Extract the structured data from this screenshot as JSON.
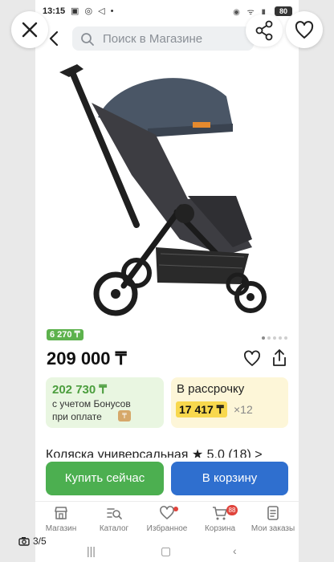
{
  "status_bar": {
    "time": "13:15",
    "left_icons": "▣ ◎ ◁ •",
    "right_icons": "◉ ᯤ ▮",
    "battery": "80"
  },
  "search": {
    "placeholder": "Поиск в Магазине"
  },
  "overlay": {
    "counter": "3/5"
  },
  "product": {
    "bonus": "6 270 ₸",
    "price": "209 000 ₸",
    "bonus_price": "202 730 ₸",
    "bonus_line1": "с учетом Бонусов",
    "bonus_line2": "при оплате",
    "installment_title": "В рассрочку",
    "installment_monthly": "17 417 ₸",
    "installment_mult": "×12",
    "title_cut": "Коляска универсальная ★ 5.0 (18) >",
    "image_pager": {
      "total": 5,
      "active": 0
    }
  },
  "actions": {
    "buy_now": "Купить сейчас",
    "to_cart": "В корзину"
  },
  "bottom_nav": [
    {
      "label": "Магазин",
      "icon": "store-icon"
    },
    {
      "label": "Каталог",
      "icon": "catalog-icon"
    },
    {
      "label": "Избранное",
      "icon": "heart-icon"
    },
    {
      "label": "Корзина",
      "icon": "cart-icon",
      "badge": "88"
    },
    {
      "label": "Мои заказы",
      "icon": "orders-icon"
    }
  ],
  "colors": {
    "green": "#4caf50",
    "blue": "#2f6fcf",
    "yellow": "#f8d84d",
    "badge": "#e0433b"
  }
}
